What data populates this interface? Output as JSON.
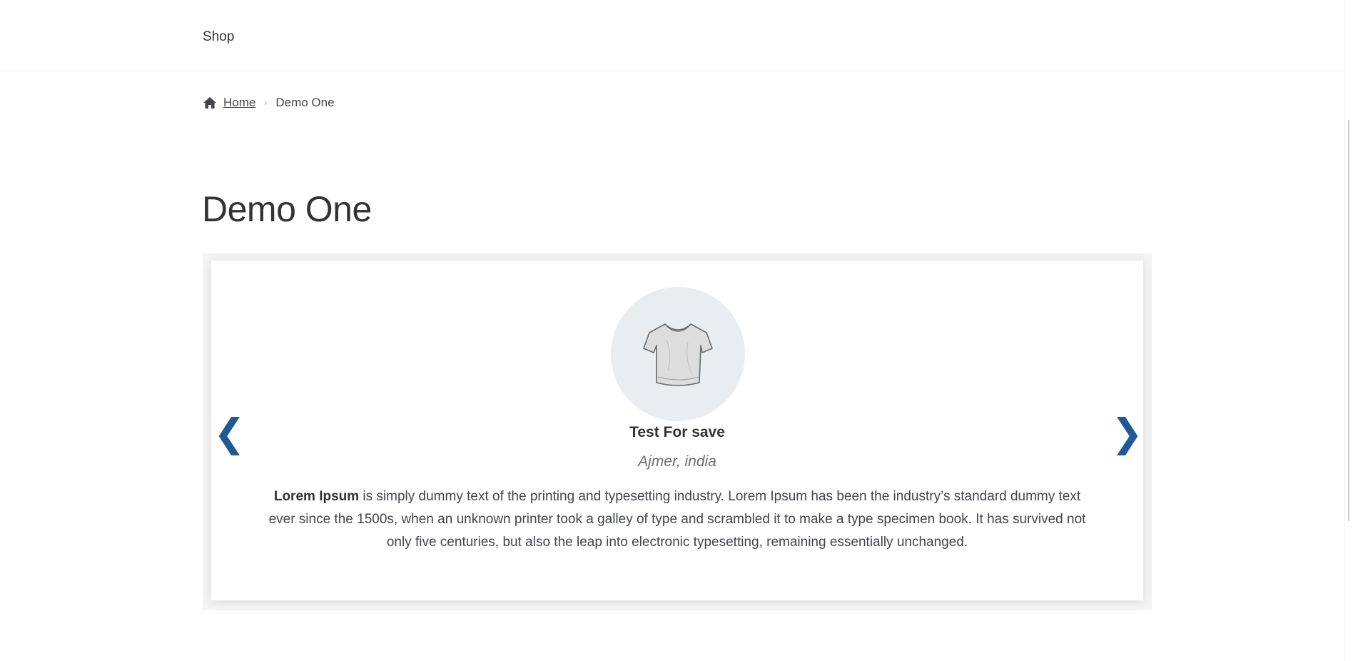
{
  "header": {
    "nav": [
      {
        "label": "Shop"
      }
    ]
  },
  "breadcrumb": {
    "home_label": "Home",
    "separator": "›",
    "current": "Demo One"
  },
  "page": {
    "title": "Demo One"
  },
  "slider": {
    "prev_symbol": "❮",
    "next_symbol": "❯",
    "arrow_color": "#1f5a96",
    "testimonial": {
      "image_icon": "tshirt-icon",
      "name": "Test For save",
      "location": "Ajmer, india",
      "text_bold": "Lorem Ipsum",
      "text_rest": " is simply dummy text of the printing and typesetting industry. Lorem Ipsum has been the industry’s standard dummy text ever since the 1500s, when an unknown printer took a galley of type and scrambled it to make a type specimen book. It has survived not only five centuries, but also the leap into electronic typesetting, remaining essentially unchanged."
    }
  }
}
